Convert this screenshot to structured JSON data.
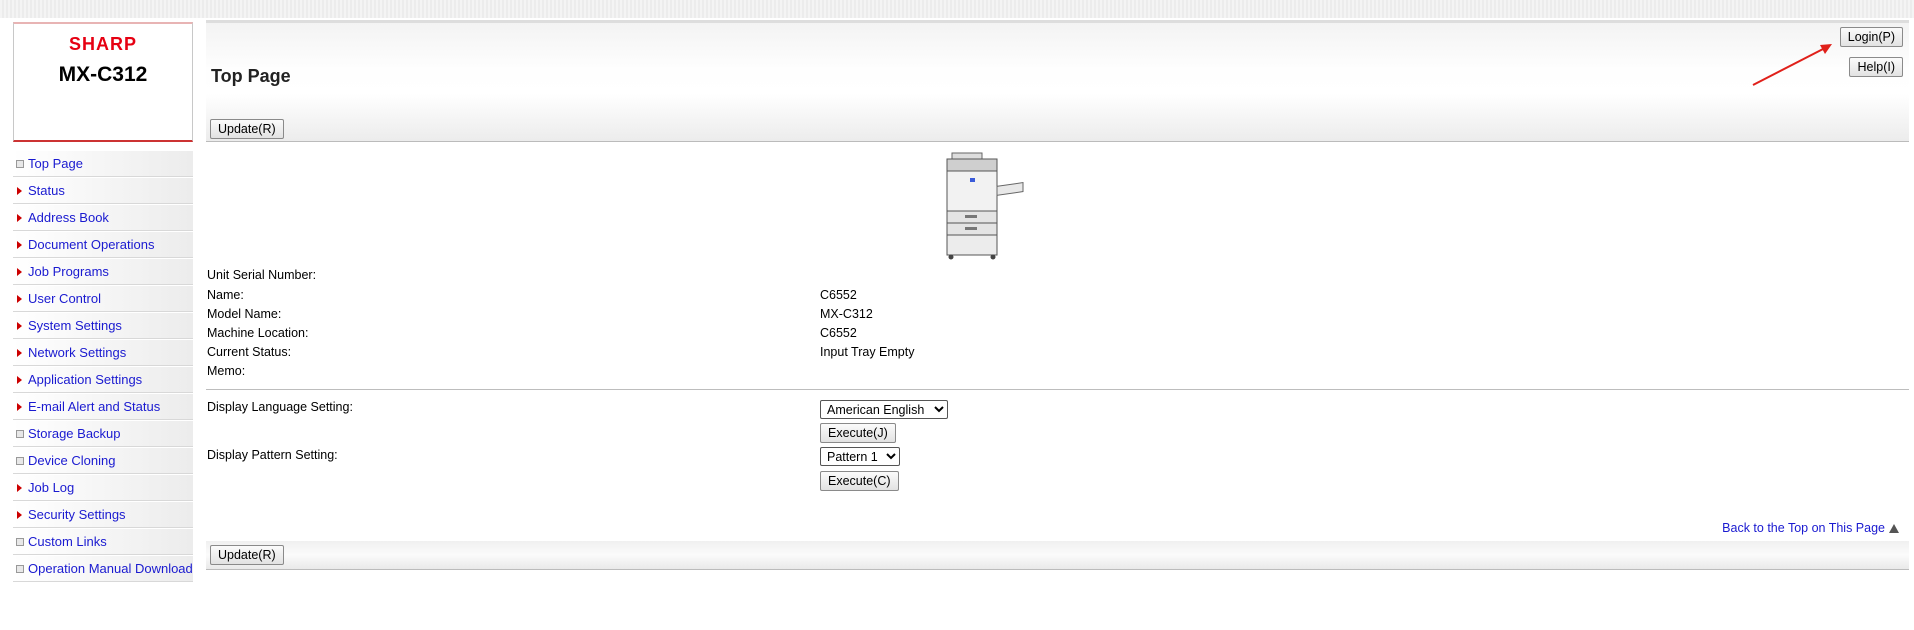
{
  "logo": {
    "brand": "SHARP",
    "model": "MX-C312"
  },
  "sidebar": {
    "items": [
      {
        "label": "Top Page",
        "mark": "box"
      },
      {
        "label": "Status",
        "mark": "arrow"
      },
      {
        "label": "Address Book",
        "mark": "arrow"
      },
      {
        "label": "Document Operations",
        "mark": "arrow"
      },
      {
        "label": "Job Programs",
        "mark": "arrow"
      },
      {
        "label": "User Control",
        "mark": "arrow"
      },
      {
        "label": "System Settings",
        "mark": "arrow"
      },
      {
        "label": "Network Settings",
        "mark": "arrow"
      },
      {
        "label": "Application Settings",
        "mark": "arrow"
      },
      {
        "label": "E-mail Alert and Status",
        "mark": "arrow"
      },
      {
        "label": "Storage Backup",
        "mark": "box"
      },
      {
        "label": "Device Cloning",
        "mark": "box"
      },
      {
        "label": "Job Log",
        "mark": "arrow"
      },
      {
        "label": "Security Settings",
        "mark": "arrow"
      },
      {
        "label": "Custom Links",
        "mark": "box"
      },
      {
        "label": "Operation Manual Download",
        "mark": "box"
      }
    ]
  },
  "header": {
    "title": "Top Page",
    "login_label": "Login(P)",
    "help_label": "Help(I)",
    "update_label": "Update(R)",
    "annotation_color": "#e0201a"
  },
  "info": {
    "serial_label": "Unit Serial Number:",
    "serial_value": "",
    "name_label": "Name:",
    "name_value": "C6552",
    "model_label": "Model Name:",
    "model_value": "MX-C312",
    "location_label": "Machine Location:",
    "location_value": "C6552",
    "status_label": "Current Status:",
    "status_value": "Input Tray Empty",
    "memo_label": "Memo:",
    "memo_value": ""
  },
  "settings": {
    "language_label": "Display Language Setting:",
    "language_selected": "American English",
    "execute_j_label": "Execute(J)",
    "pattern_label": "Display Pattern Setting:",
    "pattern_selected": "Pattern 1",
    "execute_c_label": "Execute(C)"
  },
  "footer": {
    "back_to_top": "Back to the Top on This Page",
    "update_label": "Update(R)"
  },
  "colors": {
    "link": "#1a1ad0",
    "brand": "#e60012",
    "nav_arrow": "#cc0000"
  }
}
